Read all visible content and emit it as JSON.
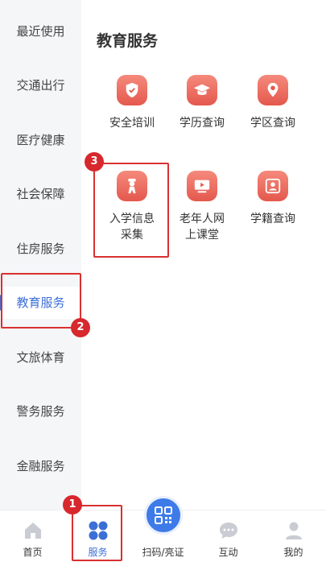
{
  "sidebar": {
    "items": [
      {
        "label": "最近使用"
      },
      {
        "label": "交通出行"
      },
      {
        "label": "医疗健康"
      },
      {
        "label": "社会保障"
      },
      {
        "label": "住房服务"
      },
      {
        "label": "教育服务",
        "active": true
      },
      {
        "label": "文旅体育"
      },
      {
        "label": "警务服务"
      },
      {
        "label": "金融服务"
      }
    ]
  },
  "main": {
    "title": "教育服务",
    "services": [
      {
        "label": "安全培训",
        "icon": "shield-icon"
      },
      {
        "label": "学历查询",
        "icon": "graduation-cap-icon"
      },
      {
        "label": "学区查询",
        "icon": "location-pin-icon"
      },
      {
        "label_line1": "入学信息",
        "label_line2": "采集",
        "icon": "student-icon"
      },
      {
        "label_line1": "老年人网",
        "label_line2": "上课堂",
        "icon": "video-play-icon"
      },
      {
        "label": "学籍查询",
        "icon": "student-card-icon"
      }
    ]
  },
  "annotations": {
    "badge1": "1",
    "badge2": "2",
    "badge3": "3",
    "color": "#d7282d"
  },
  "tabbar": {
    "items": [
      {
        "label": "首页",
        "icon": "home-icon"
      },
      {
        "label": "服务",
        "icon": "services-grid-icon",
        "active": true
      },
      {
        "label": "扫码/亮证",
        "icon": "qr-code-icon"
      },
      {
        "label": "互动",
        "icon": "chat-bubble-icon"
      },
      {
        "label": "我的",
        "icon": "user-icon"
      }
    ]
  },
  "colors": {
    "accent": "#3c6fd6",
    "icon_red": "#e4584d",
    "sidebar_bg": "#f5f6f8"
  }
}
